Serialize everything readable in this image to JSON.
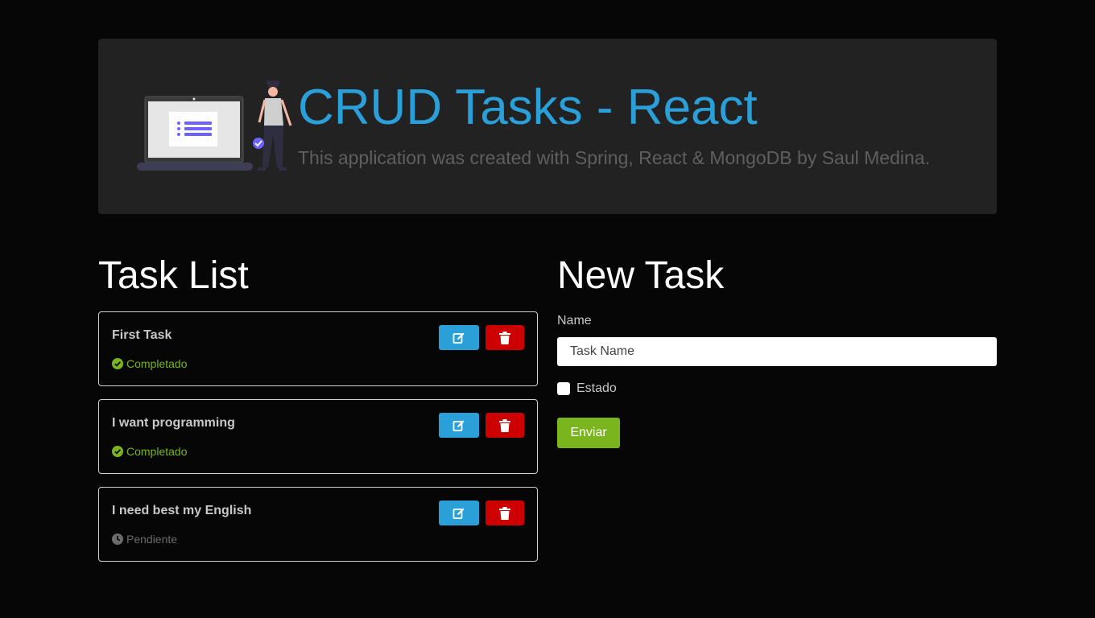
{
  "header": {
    "title": "CRUD Tasks - React",
    "subtitle": "This application was created with Spring, React & MongoDB by Saul Medina."
  },
  "task_list": {
    "title": "Task List",
    "tasks": [
      {
        "name": "First Task",
        "status": "Completado",
        "state": "done"
      },
      {
        "name": "I want programming",
        "status": "Completado",
        "state": "done"
      },
      {
        "name": "I need best my English",
        "status": "Pendiente",
        "state": "pending"
      }
    ],
    "edit_icon": "edit-icon",
    "delete_icon": "trash-icon"
  },
  "new_task": {
    "title": "New Task",
    "name_label": "Name",
    "name_placeholder": "Task Name",
    "name_value": "",
    "estado_label": "Estado",
    "estado_checked": false,
    "submit_label": "Enviar"
  },
  "colors": {
    "accent_blue": "#2b9fd8",
    "success_green": "#7ab51d",
    "danger_red": "#cc0000",
    "background": "#060606",
    "panel": "#222222"
  }
}
